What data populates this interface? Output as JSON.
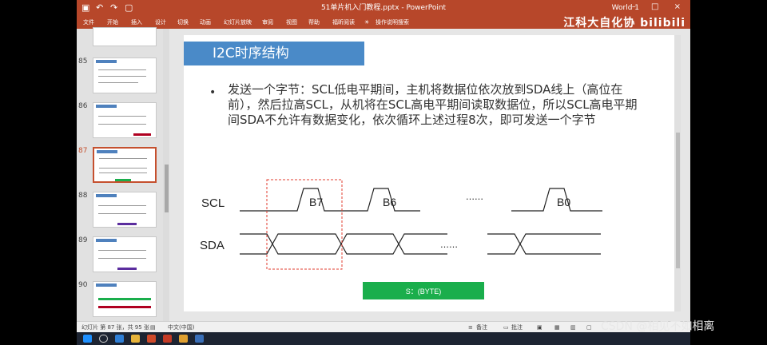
{
  "window": {
    "title": "51单片机入门教程.pptx - PowerPoint",
    "user": "World 1",
    "controls": "–  □  ×"
  },
  "ribbon": {
    "tabs": [
      "文件",
      "开始",
      "插入",
      "设计",
      "切换",
      "动画",
      "幻灯片放映",
      "审阅",
      "视图",
      "帮助",
      "福昕阅读",
      "操作说明搜索"
    ],
    "brand": "江科大自化协 bilibili"
  },
  "thumbnails": {
    "numbers": [
      "85",
      "86",
      "87",
      "88",
      "89",
      "90"
    ],
    "active": "87"
  },
  "slide": {
    "title": "I2C时序结构",
    "bullet": "发送一个字节：SCL低电平期间，主机将数据位依次放到SDA线上（高位在前），然后拉高SCL，从机将在SCL高电平期间读取数据位，所以SCL高电平期间SDA不允许有数据变化，依次循环上述过程8次，即可发送一个字节",
    "diagram": {
      "scl_label": "SCL",
      "sda_label": "SDA",
      "bit_labels": [
        "B7",
        "B6",
        "B0"
      ],
      "ellipsis_scl": "……",
      "ellipsis_sda": "……",
      "box_label": "S：(BYTE)",
      "box_color": "#1aae4c"
    }
  },
  "status": {
    "slide_info": "幻灯片 第 87 张，共 95 张",
    "language": "中文(中国)",
    "notes": "备注",
    "comments": "批注"
  },
  "watermark": "CSDN @相见不如相离",
  "colors": {
    "accent": "#b7472a",
    "title_box": "#4a8ac8"
  }
}
